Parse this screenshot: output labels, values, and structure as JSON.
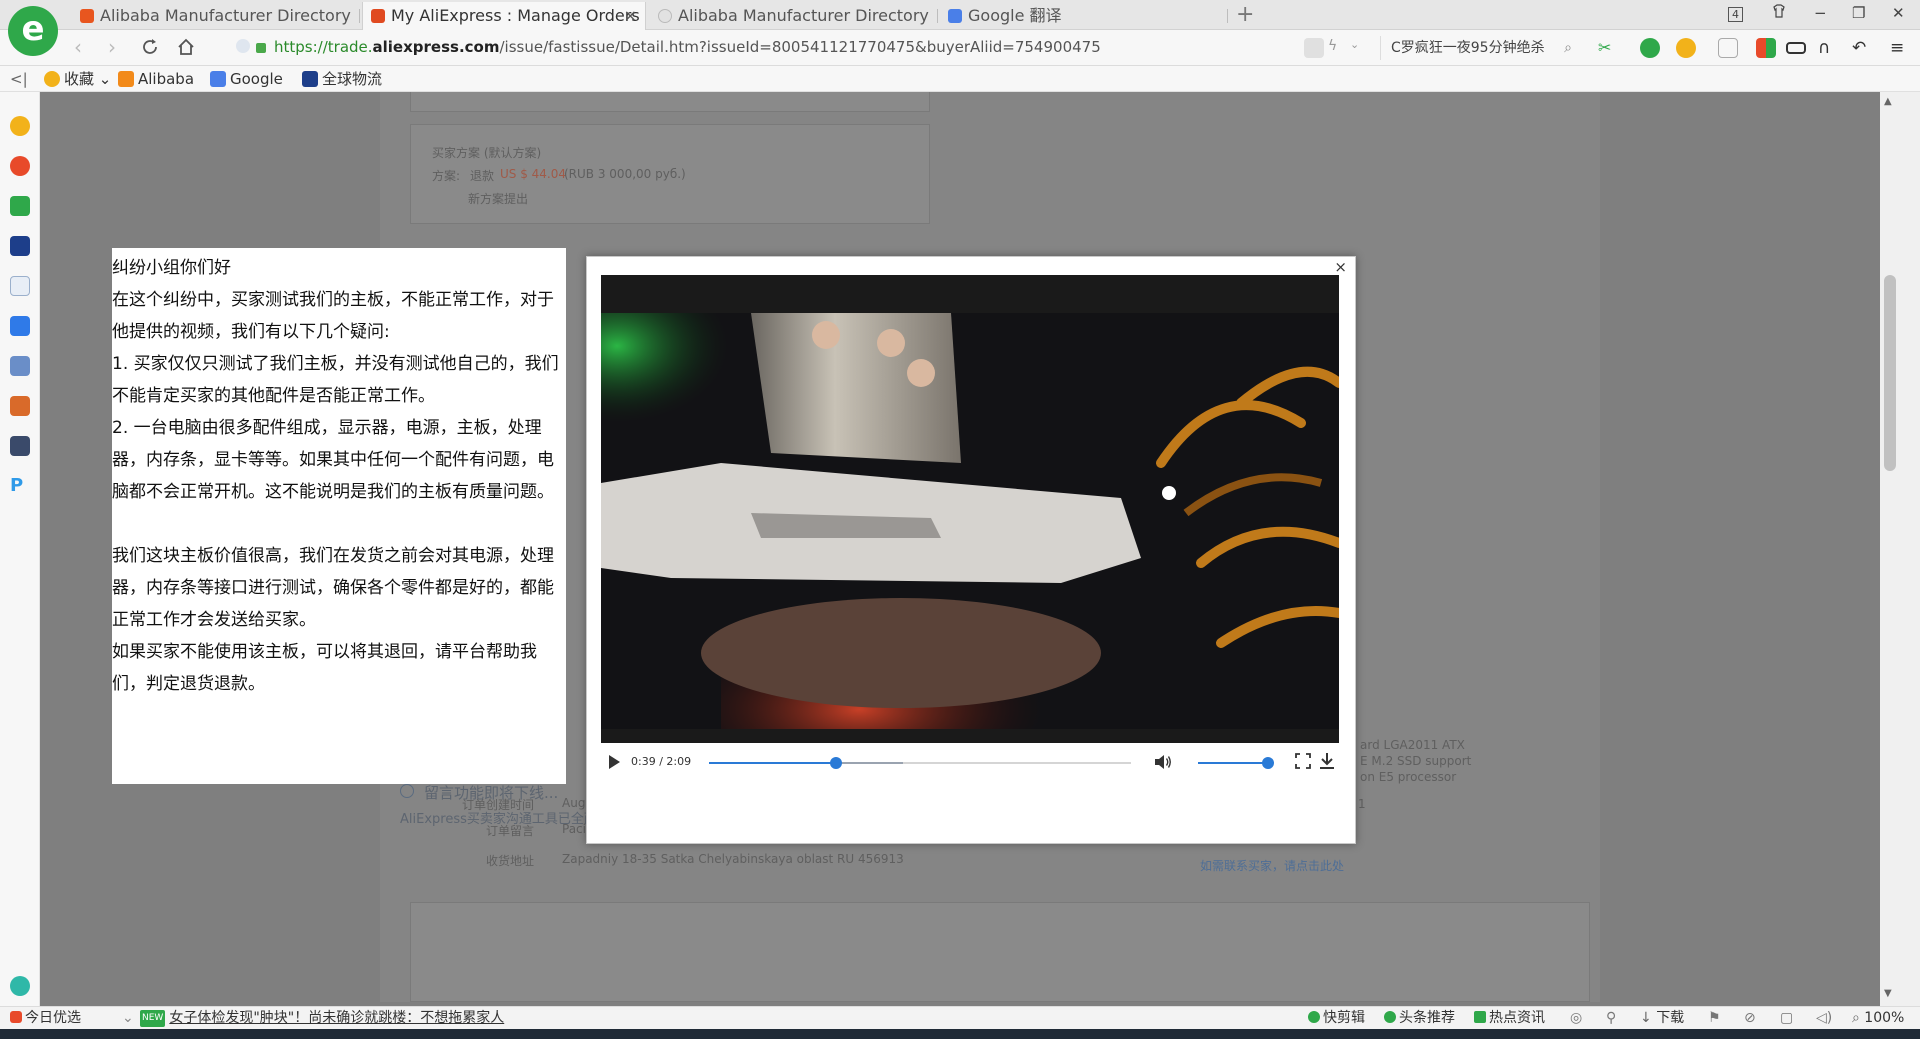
{
  "tabs": [
    {
      "title": "Alibaba Manufacturer Directory",
      "favicon_color": "#e8561f",
      "active": false
    },
    {
      "title": "My AliExpress : Manage Orders",
      "favicon_color": "#e04a20",
      "active": true,
      "close": "×"
    },
    {
      "title": "Alibaba Manufacturer Directory",
      "favicon_color": "#cfcfcf",
      "active": false
    },
    {
      "title": "Google 翻译",
      "favicon_color": "#4a7fe8",
      "active": false
    }
  ],
  "new_tab_label": "+",
  "window_controls": {
    "tab_count": "4",
    "minimize": "−",
    "maximize": "❐",
    "close": "✕"
  },
  "address": {
    "url_prefix": "https://trade.",
    "url_domain": "aliexpress.com",
    "url_suffix": "/issue/fastissue/Detail.htm?issueId=8005411217704​75&buyerAliid=754900475"
  },
  "search": {
    "text": "C罗疯狂一夜95分钟绝杀",
    "icon": "search-icon"
  },
  "bookmarks": [
    {
      "label": "收藏",
      "icon": "star-icon",
      "color": "#f2b21a"
    },
    {
      "label": "Alibaba",
      "icon": "alibaba-icon",
      "color": "#f28a1a"
    },
    {
      "label": "Google",
      "icon": "google-icon",
      "color": "#4a7fe8"
    },
    {
      "label": "全球物流",
      "icon": "logistics-icon",
      "color": "#1d3e8a"
    }
  ],
  "bg_page": {
    "buyer_plan_title": "买家方案 (默认方案)",
    "plan_label": "方案:",
    "plan_refund": "退款",
    "plan_amount": "US $ 44.04",
    "plan_rub": "(RUB 3 000,00 руб.)",
    "new_plan_label": "新方案提出",
    "order_created_label": "订单创建时间",
    "order_created_value": "Aug",
    "order_note_label": "订单留言",
    "order_note_value": "Paci",
    "address_label": "收货地址",
    "address_value": "Zapadniy 18-35 Satka Chelyabinskaya oblast RU 456913",
    "product_line1": "ard LGA2011 ATX",
    "product_line2": "E M.2 SSD support",
    "product_line3": "on E5 processor",
    "product_num": "1",
    "contact_buyer": "如需联系买家，请点击此处",
    "notice_title": "留言功能即将下线...",
    "notice_text": "AliExpress买卖家沟通工具已全面升级，原有留言功能即将下线。建议您使用新版沟通工具联系买家，点击下方按钮即可在新版沟通工具中发起会话。"
  },
  "text_panel": {
    "paragraphs": [
      "纠纷小组你们好",
      "在这个纠纷中，买家测试我们的主板，不能正常工作，对于他提供的视频，我们有以下几个疑问:",
      "1. 买家仅仅只测试了我们主板，并没有测试他自己的，我们不能肯定买家的其他配件是否能正常工作。",
      "2. 一台电脑由很多配件组成，显示器，电源，主板，处理器，内存条，显卡等等。如果其中任何一个配件有问题，电脑都不会正常开机。这不能说明是我们的主板有质量问题。",
      "",
      "我们这块主板价值很高，我们在发货之前会对其电源，处理器，内存条等接口进行测试，确保各个零件都是好的，都能正常工作才会发送给买家。",
      "如果买家不能使用该主板，可以将其退回，请平台帮助我们，判定退货退款。"
    ]
  },
  "video": {
    "close_label": "×",
    "time_text": "0:39 / 2:09",
    "progress": 0.302,
    "buffered": 0.46,
    "volume": 1.0,
    "accent": "#2a7ad6"
  },
  "statusbar": {
    "today": "今日优选",
    "news_badge": "NEW",
    "news": "女子体检发现\"肿块\"！尚未确诊就跳楼：不想拖累家人",
    "quick_edit": "快剪辑",
    "headlines": "头条推荐",
    "hot_news": "热点资讯",
    "download": "下载",
    "zoom": "100%"
  }
}
